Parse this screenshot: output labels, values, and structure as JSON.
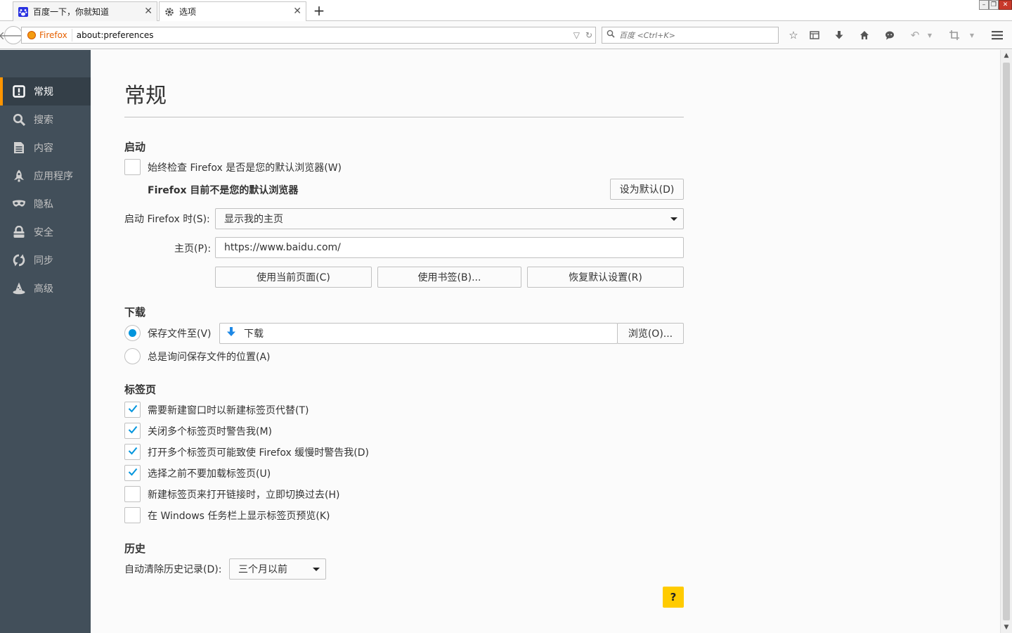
{
  "tabs": [
    {
      "title": "百度一下，你就知道",
      "icon": "baidu-paw-icon"
    },
    {
      "title": "选项",
      "icon": "gear-icon"
    }
  ],
  "navbar": {
    "identity_label": "Firefox",
    "url": "about:preferences",
    "search_placeholder": "百度 <Ctrl+K>"
  },
  "sidebar": {
    "items": [
      {
        "label": "常规",
        "icon": "general-icon",
        "selected": true
      },
      {
        "label": "搜索",
        "icon": "search-icon"
      },
      {
        "label": "内容",
        "icon": "content-icon"
      },
      {
        "label": "应用程序",
        "icon": "applications-icon"
      },
      {
        "label": "隐私",
        "icon": "privacy-mask-icon"
      },
      {
        "label": "安全",
        "icon": "security-lock-icon"
      },
      {
        "label": "同步",
        "icon": "sync-icon"
      },
      {
        "label": "高级",
        "icon": "advanced-wizard-hat-icon"
      }
    ]
  },
  "page": {
    "title": "常规",
    "startup": {
      "heading": "启动",
      "default_check_label": "始终检查 Firefox 是否是您的默认浏览器(W)",
      "default_check_checked": false,
      "not_default_text": "Firefox 目前不是您的默认浏览器",
      "set_default_button": "设为默认(D)",
      "when_starts_label": "启动 Firefox 时(S):",
      "when_starts_value": "显示我的主页",
      "homepage_label": "主页(P):",
      "homepage_value": "https://www.baidu.com/",
      "use_current_button": "使用当前页面(C)",
      "use_bookmark_button": "使用书签(B)...",
      "restore_default_button": "恢复默认设置(R)"
    },
    "downloads": {
      "heading": "下载",
      "save_to_label": "保存文件至(V)",
      "save_to_selected": true,
      "folder_name": "下载",
      "browse_button": "浏览(O)...",
      "always_ask_label": "总是询问保存文件的位置(A)",
      "always_ask_selected": false
    },
    "tabs_section": {
      "heading": "标签页",
      "options": [
        {
          "label": "需要新建窗口时以新建标签页代替(T)",
          "checked": true
        },
        {
          "label": "关闭多个标签页时警告我(M)",
          "checked": true
        },
        {
          "label": "打开多个标签页可能致使 Firefox 缓慢时警告我(D)",
          "checked": true
        },
        {
          "label": "选择之前不要加载标签页(U)",
          "checked": true
        },
        {
          "label": "新建标签页来打开链接时，立即切换过去(H)",
          "checked": false
        },
        {
          "label": "在 Windows 任务栏上显示标签页预览(K)",
          "checked": false
        }
      ]
    },
    "history": {
      "heading": "历史",
      "clear_label": "自动清除历史记录(D):",
      "clear_value": "三个月以前"
    },
    "help_label": "?"
  },
  "colors": {
    "sidebar_bg": "#424f5a",
    "sidebar_selected_bg": "#343f48",
    "accent_orange": "#ff9500",
    "check_blue": "#0095dd",
    "help_yellow": "#ffcb00"
  }
}
